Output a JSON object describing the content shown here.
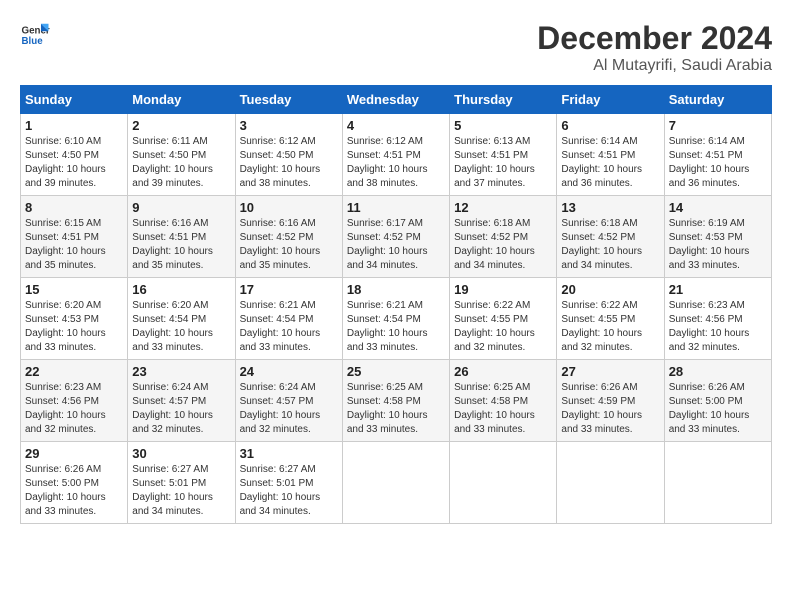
{
  "header": {
    "logo_general": "General",
    "logo_blue": "Blue",
    "title": "December 2024",
    "subtitle": "Al Mutayrifi, Saudi Arabia"
  },
  "calendar": {
    "days_of_week": [
      "Sunday",
      "Monday",
      "Tuesday",
      "Wednesday",
      "Thursday",
      "Friday",
      "Saturday"
    ],
    "weeks": [
      [
        {
          "day": 1,
          "sunrise": "6:10 AM",
          "sunset": "4:50 PM",
          "daylight": "10 hours and 39 minutes."
        },
        {
          "day": 2,
          "sunrise": "6:11 AM",
          "sunset": "4:50 PM",
          "daylight": "10 hours and 39 minutes."
        },
        {
          "day": 3,
          "sunrise": "6:12 AM",
          "sunset": "4:50 PM",
          "daylight": "10 hours and 38 minutes."
        },
        {
          "day": 4,
          "sunrise": "6:12 AM",
          "sunset": "4:51 PM",
          "daylight": "10 hours and 38 minutes."
        },
        {
          "day": 5,
          "sunrise": "6:13 AM",
          "sunset": "4:51 PM",
          "daylight": "10 hours and 37 minutes."
        },
        {
          "day": 6,
          "sunrise": "6:14 AM",
          "sunset": "4:51 PM",
          "daylight": "10 hours and 36 minutes."
        },
        {
          "day": 7,
          "sunrise": "6:14 AM",
          "sunset": "4:51 PM",
          "daylight": "10 hours and 36 minutes."
        }
      ],
      [
        {
          "day": 8,
          "sunrise": "6:15 AM",
          "sunset": "4:51 PM",
          "daylight": "10 hours and 35 minutes."
        },
        {
          "day": 9,
          "sunrise": "6:16 AM",
          "sunset": "4:51 PM",
          "daylight": "10 hours and 35 minutes."
        },
        {
          "day": 10,
          "sunrise": "6:16 AM",
          "sunset": "4:52 PM",
          "daylight": "10 hours and 35 minutes."
        },
        {
          "day": 11,
          "sunrise": "6:17 AM",
          "sunset": "4:52 PM",
          "daylight": "10 hours and 34 minutes."
        },
        {
          "day": 12,
          "sunrise": "6:18 AM",
          "sunset": "4:52 PM",
          "daylight": "10 hours and 34 minutes."
        },
        {
          "day": 13,
          "sunrise": "6:18 AM",
          "sunset": "4:52 PM",
          "daylight": "10 hours and 34 minutes."
        },
        {
          "day": 14,
          "sunrise": "6:19 AM",
          "sunset": "4:53 PM",
          "daylight": "10 hours and 33 minutes."
        }
      ],
      [
        {
          "day": 15,
          "sunrise": "6:20 AM",
          "sunset": "4:53 PM",
          "daylight": "10 hours and 33 minutes."
        },
        {
          "day": 16,
          "sunrise": "6:20 AM",
          "sunset": "4:54 PM",
          "daylight": "10 hours and 33 minutes."
        },
        {
          "day": 17,
          "sunrise": "6:21 AM",
          "sunset": "4:54 PM",
          "daylight": "10 hours and 33 minutes."
        },
        {
          "day": 18,
          "sunrise": "6:21 AM",
          "sunset": "4:54 PM",
          "daylight": "10 hours and 33 minutes."
        },
        {
          "day": 19,
          "sunrise": "6:22 AM",
          "sunset": "4:55 PM",
          "daylight": "10 hours and 32 minutes."
        },
        {
          "day": 20,
          "sunrise": "6:22 AM",
          "sunset": "4:55 PM",
          "daylight": "10 hours and 32 minutes."
        },
        {
          "day": 21,
          "sunrise": "6:23 AM",
          "sunset": "4:56 PM",
          "daylight": "10 hours and 32 minutes."
        }
      ],
      [
        {
          "day": 22,
          "sunrise": "6:23 AM",
          "sunset": "4:56 PM",
          "daylight": "10 hours and 32 minutes."
        },
        {
          "day": 23,
          "sunrise": "6:24 AM",
          "sunset": "4:57 PM",
          "daylight": "10 hours and 32 minutes."
        },
        {
          "day": 24,
          "sunrise": "6:24 AM",
          "sunset": "4:57 PM",
          "daylight": "10 hours and 32 minutes."
        },
        {
          "day": 25,
          "sunrise": "6:25 AM",
          "sunset": "4:58 PM",
          "daylight": "10 hours and 33 minutes."
        },
        {
          "day": 26,
          "sunrise": "6:25 AM",
          "sunset": "4:58 PM",
          "daylight": "10 hours and 33 minutes."
        },
        {
          "day": 27,
          "sunrise": "6:26 AM",
          "sunset": "4:59 PM",
          "daylight": "10 hours and 33 minutes."
        },
        {
          "day": 28,
          "sunrise": "6:26 AM",
          "sunset": "5:00 PM",
          "daylight": "10 hours and 33 minutes."
        }
      ],
      [
        {
          "day": 29,
          "sunrise": "6:26 AM",
          "sunset": "5:00 PM",
          "daylight": "10 hours and 33 minutes."
        },
        {
          "day": 30,
          "sunrise": "6:27 AM",
          "sunset": "5:01 PM",
          "daylight": "10 hours and 34 minutes."
        },
        {
          "day": 31,
          "sunrise": "6:27 AM",
          "sunset": "5:01 PM",
          "daylight": "10 hours and 34 minutes."
        },
        null,
        null,
        null,
        null
      ]
    ],
    "labels": {
      "sunrise": "Sunrise:",
      "sunset": "Sunset:",
      "daylight": "Daylight:"
    }
  }
}
